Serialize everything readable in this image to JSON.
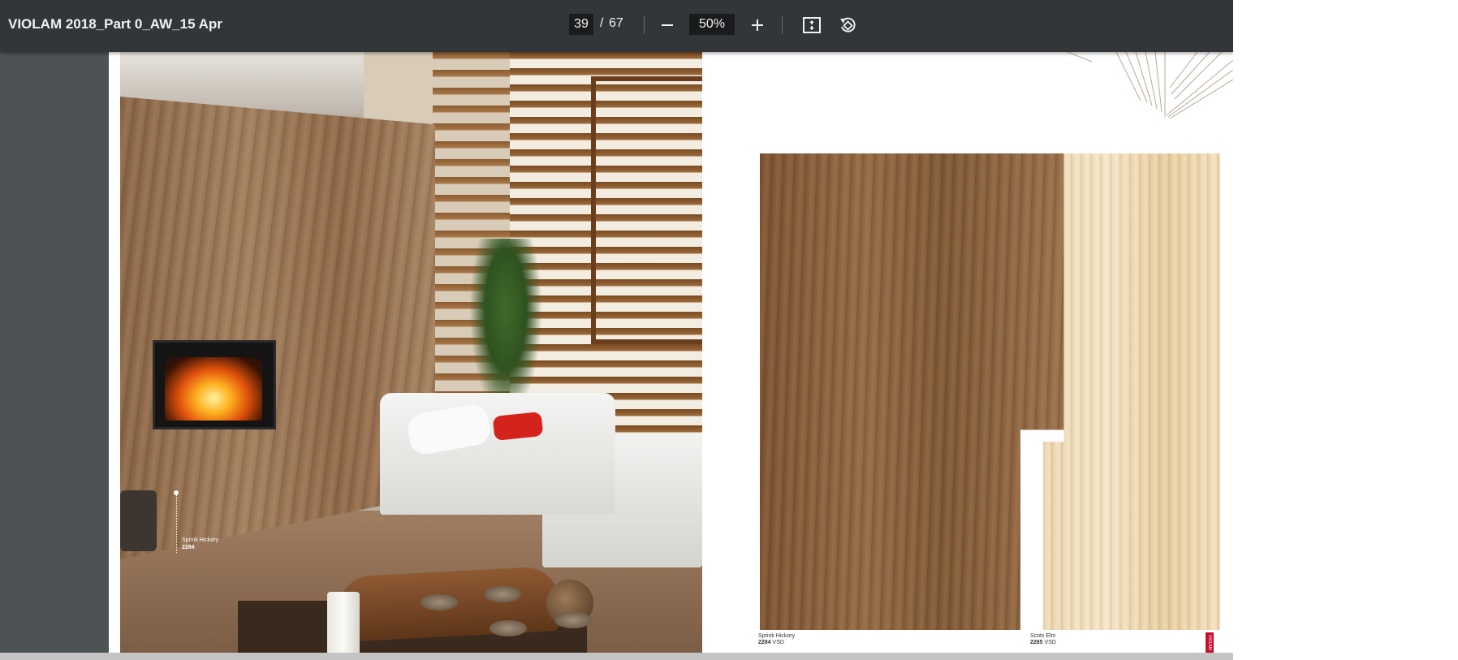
{
  "toolbar": {
    "title": "VIOLAM 2018_Part 0_AW_15 Apr",
    "page_current": "39",
    "page_separator": "/",
    "page_total": "67",
    "zoom_value": "50%",
    "icons": {
      "zoom_out": "minus-icon",
      "zoom_in": "plus-icon",
      "fit": "fit-to-page-icon",
      "rotate": "rotate-icon"
    }
  },
  "left_page": {
    "callout_name": "Sprink Hickory",
    "callout_code": "2284"
  },
  "right_page": {
    "swatches": [
      {
        "name": "Sprink Hickory",
        "code": "2284",
        "finish": "VSD"
      },
      {
        "name": "Scots Elm",
        "code": "2285",
        "finish": "VSD"
      }
    ],
    "tab_text": "VIOLAM"
  },
  "colors": {
    "toolbar_bg": "#323639",
    "viewer_bg": "#525659",
    "accent_red": "#c8102e"
  }
}
